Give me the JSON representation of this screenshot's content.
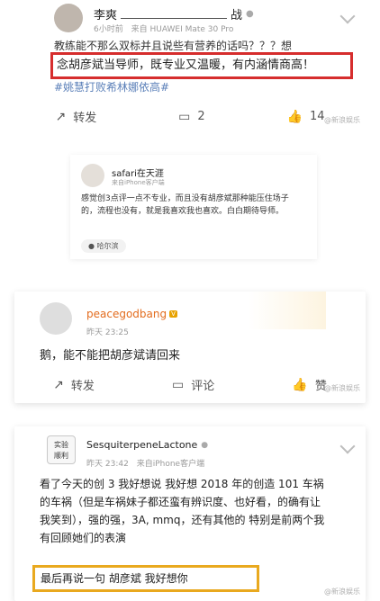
{
  "post1": {
    "username": "李爽",
    "user_suffix": "战",
    "time": "6小时前",
    "source": "来自 HUAWEI Mate 30 Pro",
    "text_line1": "教练能不那么双标并且说些有营养的话吗？？？想",
    "highlight": "念胡彦斌当导师，既专业又温暖，有内涵情商高！",
    "hashtag": "#姚慧打败希林娜依高#",
    "repost_label": "转发",
    "comment_count": "2",
    "like_count": "14"
  },
  "post2": {
    "username": "safari在天涯",
    "source": "来自iPhone客户端",
    "text": "感觉创3点评一点不专业，而且没有胡彦斌那种能压住场子的，流程也没有，就是我喜欢我也喜欢。白白期待导师。",
    "location": "哈尔滨"
  },
  "post3": {
    "username": "peacegodbang",
    "time": "昨天 23:25",
    "text": "鹅，能不能把胡彦斌请回来",
    "repost_label": "转发",
    "comment_label": "评论",
    "like_label": "赞"
  },
  "post4": {
    "username": "SesquiterpeneLactone",
    "avatar_text_line1": "实验",
    "avatar_text_line2": "顺利",
    "time": "昨天 23:42",
    "source": "来自iPhone客户端",
    "text": "看了今天的创 3 我好想说 我好想 2018 年的创造 101 车祸的车祸（但是车祸妹子都还蛮有辨识度、也好看，的确有让我笑到），强的强，3A, mmq，还有其他的 特别是前两个我有回顾她们的表演",
    "highlight": "最后再说一句 胡彦斌 我好想你"
  },
  "watermark": "@新浪娱乐"
}
